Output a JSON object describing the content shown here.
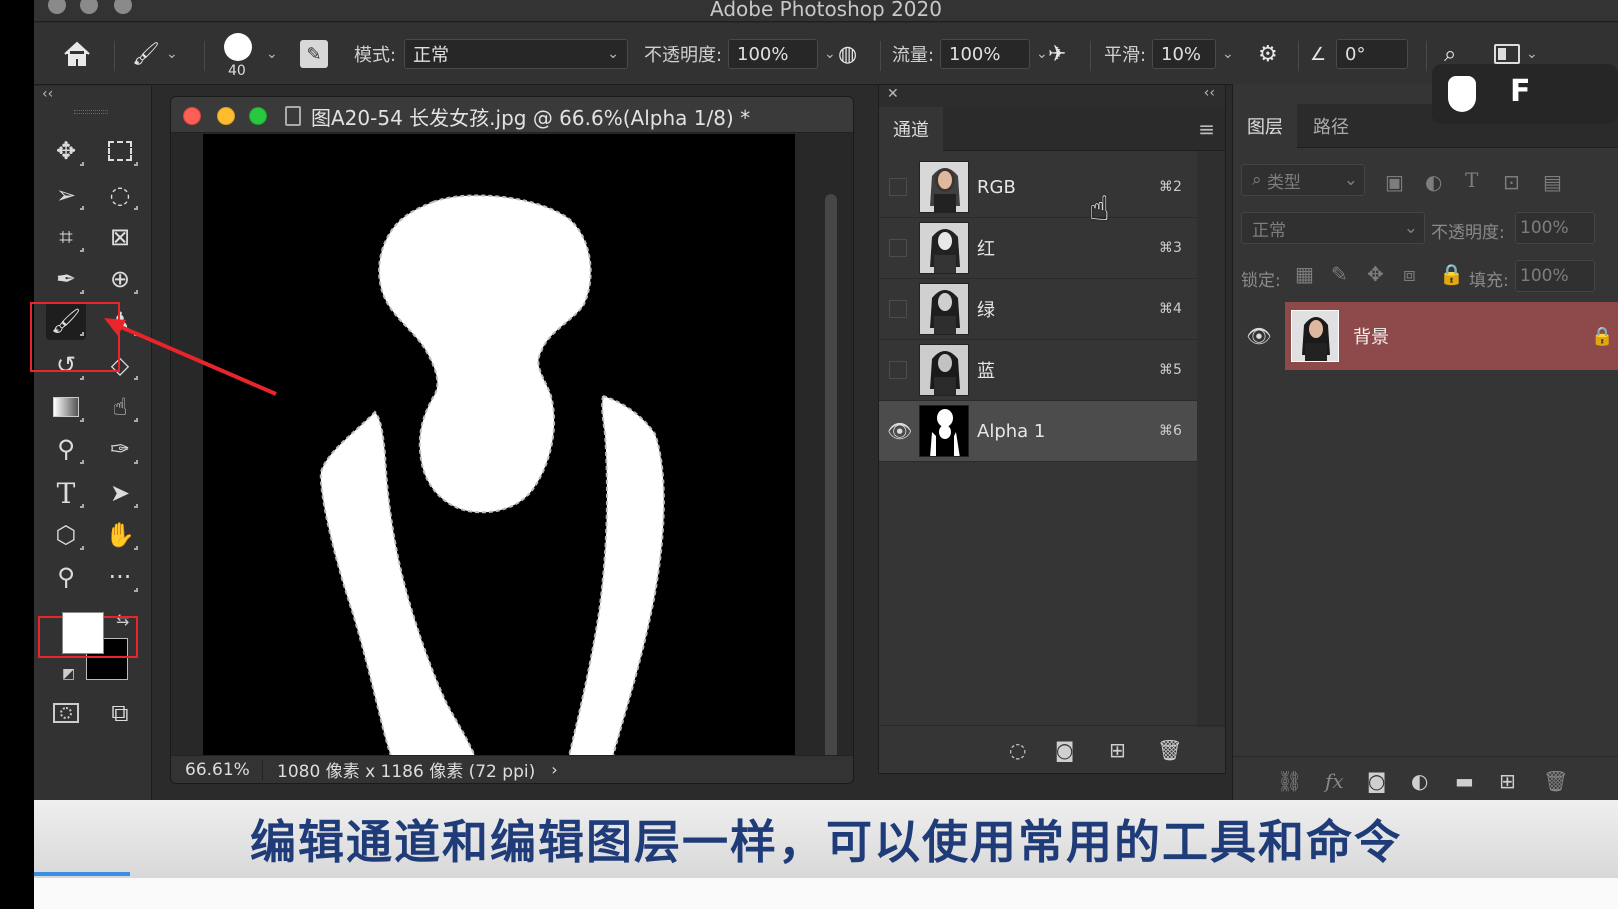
{
  "window": {
    "title": "Adobe Photoshop 2020"
  },
  "options_bar": {
    "brush_size": "40",
    "mode_label": "模式:",
    "mode_value": "正常",
    "opacity_label": "不透明度:",
    "opacity_value": "100%",
    "flow_label": "流量:",
    "flow_value": "100%",
    "smoothing_label": "平滑:",
    "smoothing_value": "10%",
    "angle_value": "0°"
  },
  "overlay_keys": {
    "key_label": "F"
  },
  "document": {
    "title": "图A20-54 长发女孩.jpg @ 66.6%(Alpha 1/8) *",
    "zoom": "66.61%",
    "info": "1080 像素 x 1186 像素 (72 ppi)"
  },
  "channels_panel": {
    "tab_label": "通道",
    "rows": [
      {
        "name": "RGB",
        "shortcut": "⌘2",
        "visible": false
      },
      {
        "name": "红",
        "shortcut": "⌘3",
        "visible": false
      },
      {
        "name": "绿",
        "shortcut": "⌘4",
        "visible": false
      },
      {
        "name": "蓝",
        "shortcut": "⌘5",
        "visible": false
      },
      {
        "name": "Alpha 1",
        "shortcut": "⌘6",
        "visible": true,
        "selected": true
      }
    ]
  },
  "layers_panel": {
    "tabs": [
      "图层",
      "路径"
    ],
    "filter_placeholder": "类型",
    "blend_mode": "正常",
    "opacity_label": "不透明度:",
    "opacity_value": "100%",
    "lock_label": "锁定:",
    "fill_label": "填充:",
    "fill_value": "100%",
    "layer_name": "背景"
  },
  "subtitle": "编辑通道和编辑图层一样，可以使用常用的工具和命令",
  "colors": {
    "accent_red": "#e8252a",
    "selected_layer": "#8e4a4a",
    "subtitle_text": "#1f3c78"
  }
}
